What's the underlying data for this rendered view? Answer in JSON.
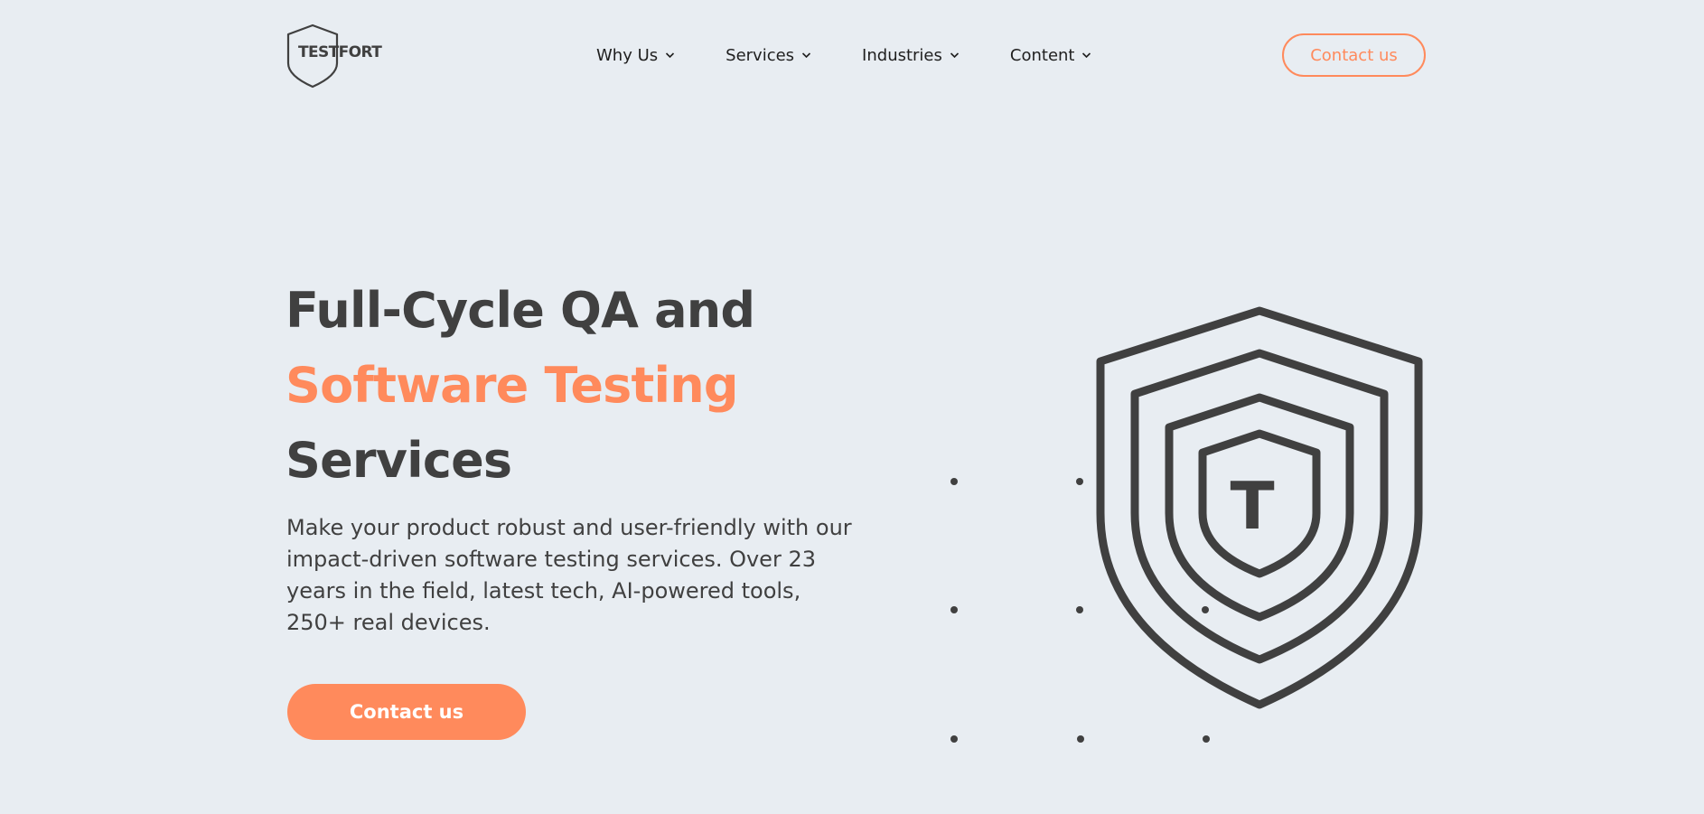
{
  "header": {
    "logo_text": "TESTFORT",
    "nav": [
      {
        "label": "Why Us",
        "icon": "chevron-down-icon"
      },
      {
        "label": "Services",
        "icon": "chevron-down-icon"
      },
      {
        "label": "Industries",
        "icon": "chevron-down-icon"
      },
      {
        "label": "Content",
        "icon": "chevron-down-icon"
      }
    ],
    "cta_label": "Contact us"
  },
  "hero": {
    "title_line1": "Full-Cycle QA and",
    "title_line2": "Software Testing",
    "title_line3": "Services",
    "description": "Make your product robust and user-friendly with our impact-driven software testing services. Over 23 years in the field, latest tech, AI-powered tools, 250+ real devices.",
    "cta_label": "Contact us"
  },
  "illustration": {
    "shield_letter": "T",
    "icon": "shield-icon"
  },
  "colors": {
    "background": "#e8edf2",
    "accent": "#ff8a5c",
    "text": "#404040"
  }
}
